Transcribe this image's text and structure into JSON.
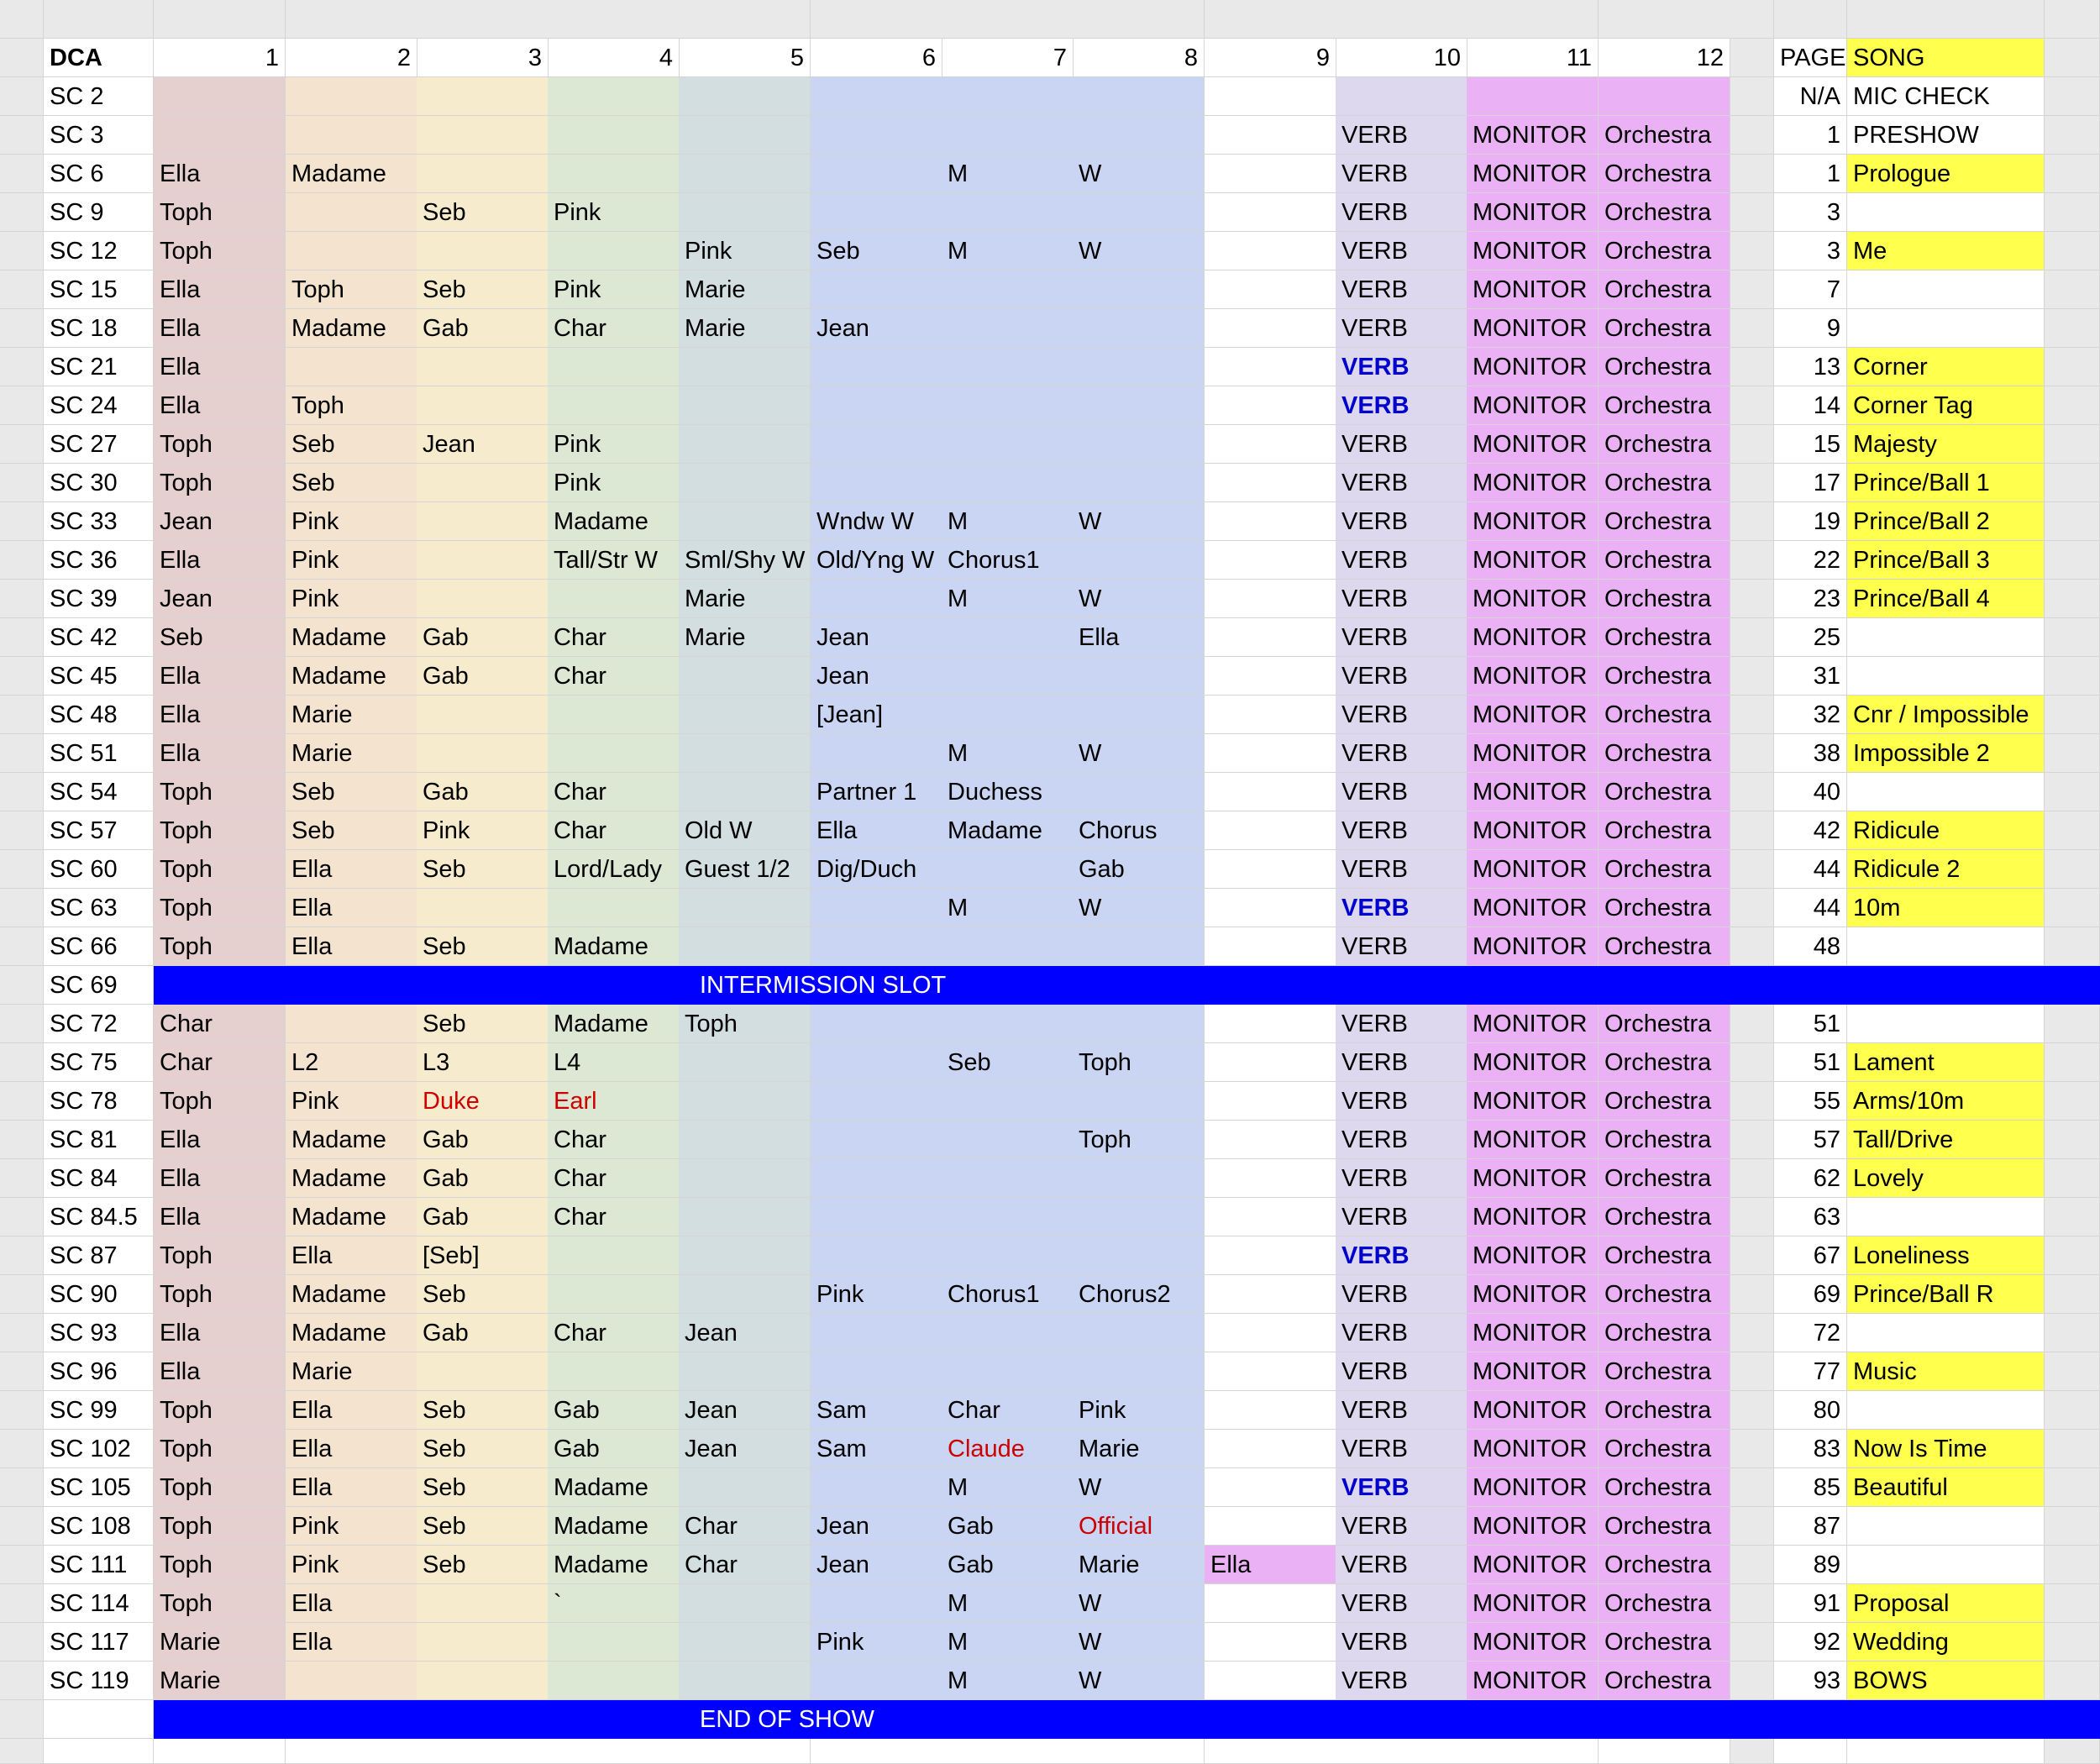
{
  "colors": {
    "ch1": "#e6cfcf",
    "ch2": "#f3e3cf",
    "ch3": "#f6ebcd",
    "ch4": "#dce7d4",
    "ch5": "#d2dee0",
    "ch6": "#cad5f3",
    "ch10": "#ddd8ee",
    "ch11": "#ebb1f5",
    "song": "#ffff4d",
    "header": "#e9e9e9",
    "banner": "#0000ff",
    "text_red": "#cc0000",
    "text_blue": "#0000cc"
  },
  "header": {
    "dca": "DCA",
    "channels": [
      "1",
      "2",
      "3",
      "4",
      "5",
      "6",
      "7",
      "8",
      "9",
      "10",
      "11",
      "12"
    ],
    "page": "PAGE",
    "song": "SONG"
  },
  "rows": [
    {
      "sc": "SC 2",
      "ch": [
        "",
        "",
        "",
        "",
        "",
        "",
        "",
        "",
        "",
        "",
        "",
        ""
      ],
      "page": "N/A",
      "song": "MIC CHECK",
      "song_hl": false
    },
    {
      "sc": "SC 3",
      "ch": [
        "",
        "",
        "",
        "",
        "",
        "",
        "",
        "",
        "",
        "VERB",
        "MONITOR",
        "Orchestra"
      ],
      "page": "1",
      "song": "PRESHOW",
      "song_hl": false
    },
    {
      "sc": "SC 6",
      "ch": [
        "Ella",
        "Madame",
        "",
        "",
        "",
        "",
        "M",
        "W",
        "",
        "VERB",
        "MONITOR",
        "Orchestra"
      ],
      "page": "1",
      "song": "Prologue",
      "song_hl": true
    },
    {
      "sc": "SC 9",
      "ch": [
        "Toph",
        "",
        "Seb",
        "Pink",
        "",
        "",
        "",
        "",
        "",
        "VERB",
        "MONITOR",
        "Orchestra"
      ],
      "page": "3",
      "song": "",
      "song_hl": false
    },
    {
      "sc": "SC 12",
      "ch": [
        "Toph",
        "",
        "",
        "",
        "Pink",
        "Seb",
        "M",
        "W",
        "",
        "VERB",
        "MONITOR",
        "Orchestra"
      ],
      "page": "3",
      "song": "Me",
      "song_hl": true
    },
    {
      "sc": "SC 15",
      "ch": [
        "Ella",
        "Toph",
        "Seb",
        "Pink",
        "Marie",
        "",
        "",
        "",
        "",
        "VERB",
        "MONITOR",
        "Orchestra"
      ],
      "page": "7",
      "song": "",
      "song_hl": false
    },
    {
      "sc": "SC 18",
      "ch": [
        "Ella",
        "Madame",
        "Gab",
        "Char",
        "Marie",
        "Jean",
        "",
        "",
        "",
        "VERB",
        "MONITOR",
        "Orchestra"
      ],
      "page": "9",
      "song": "",
      "song_hl": false
    },
    {
      "sc": "SC 21",
      "ch": [
        "Ella",
        "",
        "",
        "",
        "",
        "",
        "",
        "",
        "",
        "VERB",
        "MONITOR",
        "Orchestra"
      ],
      "verb_blue": true,
      "page": "13",
      "song": "Corner",
      "song_hl": true
    },
    {
      "sc": "SC 24",
      "ch": [
        "Ella",
        "Toph",
        "",
        "",
        "",
        "",
        "",
        "",
        "",
        "VERB",
        "MONITOR",
        "Orchestra"
      ],
      "verb_blue": true,
      "page": "14",
      "song": "Corner Tag",
      "song_hl": true
    },
    {
      "sc": "SC 27",
      "ch": [
        "Toph",
        "Seb",
        "Jean",
        "Pink",
        "",
        "",
        "",
        "",
        "",
        "VERB",
        "MONITOR",
        "Orchestra"
      ],
      "page": "15",
      "song": "Majesty",
      "song_hl": true
    },
    {
      "sc": "SC 30",
      "ch": [
        "Toph",
        "Seb",
        "",
        "Pink",
        "",
        "",
        "",
        "",
        "",
        "VERB",
        "MONITOR",
        "Orchestra"
      ],
      "page": "17",
      "song": "Prince/Ball 1",
      "song_hl": true
    },
    {
      "sc": "SC 33",
      "ch": [
        "Jean",
        "Pink",
        "",
        "Madame",
        "",
        "Wndw W",
        "M",
        "W",
        "",
        "VERB",
        "MONITOR",
        "Orchestra"
      ],
      "page": "19",
      "song": "Prince/Ball 2",
      "song_hl": true
    },
    {
      "sc": "SC 36",
      "ch": [
        "Ella",
        "Pink",
        "",
        "Tall/Str W",
        "Sml/Shy W",
        "Old/Yng W",
        "Chorus1",
        "",
        "",
        "VERB",
        "MONITOR",
        "Orchestra"
      ],
      "page": "22",
      "song": "Prince/Ball 3",
      "song_hl": true
    },
    {
      "sc": "SC 39",
      "ch": [
        "Jean",
        "Pink",
        "",
        "",
        "Marie",
        "",
        "M",
        "W",
        "",
        "VERB",
        "MONITOR",
        "Orchestra"
      ],
      "page": "23",
      "song": "Prince/Ball 4",
      "song_hl": true
    },
    {
      "sc": "SC 42",
      "ch": [
        "Seb",
        "Madame",
        "Gab",
        "Char",
        "Marie",
        "Jean",
        "",
        "Ella",
        "",
        "VERB",
        "MONITOR",
        "Orchestra"
      ],
      "page": "25",
      "song": "",
      "song_hl": false
    },
    {
      "sc": "SC 45",
      "ch": [
        "Ella",
        "Madame",
        "Gab",
        "Char",
        "",
        "Jean",
        "",
        "",
        "",
        "VERB",
        "MONITOR",
        "Orchestra"
      ],
      "page": "31",
      "song": "",
      "song_hl": false
    },
    {
      "sc": "SC 48",
      "ch": [
        "Ella",
        "Marie",
        "",
        "",
        "",
        "[Jean]",
        "",
        "",
        "",
        "VERB",
        "MONITOR",
        "Orchestra"
      ],
      "page": "32",
      "song": "Cnr / Impossible",
      "song_hl": true
    },
    {
      "sc": "SC 51",
      "ch": [
        "Ella",
        "Marie",
        "",
        "",
        "",
        "",
        "M",
        "W",
        "",
        "VERB",
        "MONITOR",
        "Orchestra"
      ],
      "page": "38",
      "song": "Impossible 2",
      "song_hl": true
    },
    {
      "sc": "SC 54",
      "ch": [
        "Toph",
        "Seb",
        "Gab",
        "Char",
        "",
        "Partner 1",
        "Duchess",
        "",
        "",
        "VERB",
        "MONITOR",
        "Orchestra"
      ],
      "page": "40",
      "song": "",
      "song_hl": false
    },
    {
      "sc": "SC 57",
      "ch": [
        "Toph",
        "Seb",
        "Pink",
        "Char",
        "Old W",
        "Ella",
        "Madame",
        "Chorus",
        "",
        "VERB",
        "MONITOR",
        "Orchestra"
      ],
      "page": "42",
      "song": "Ridicule",
      "song_hl": true
    },
    {
      "sc": "SC 60",
      "ch": [
        "Toph",
        "Ella",
        "Seb",
        "Lord/Lady",
        "Guest 1/2",
        "Dig/Duch",
        "",
        "Gab",
        "",
        "VERB",
        "MONITOR",
        "Orchestra"
      ],
      "page": "44",
      "song": "Ridicule 2",
      "song_hl": true
    },
    {
      "sc": "SC 63",
      "ch": [
        "Toph",
        "Ella",
        "",
        "",
        "",
        "",
        "M",
        "W",
        "",
        "VERB",
        "MONITOR",
        "Orchestra"
      ],
      "verb_blue": true,
      "page": "44",
      "song": "10m",
      "song_hl": true
    },
    {
      "sc": "SC 66",
      "ch": [
        "Toph",
        "Ella",
        "Seb",
        "Madame",
        "",
        "",
        "",
        "",
        "",
        "VERB",
        "MONITOR",
        "Orchestra"
      ],
      "page": "48",
      "song": "",
      "song_hl": false
    },
    {
      "sc": "SC 69",
      "banner": "INTERMISSION SLOT"
    },
    {
      "sc": "SC 72",
      "ch": [
        "Char",
        "",
        "Seb",
        "Madame",
        "Toph",
        "",
        "",
        "",
        "",
        "VERB",
        "MONITOR",
        "Orchestra"
      ],
      "page": "51",
      "song": "",
      "song_hl": false
    },
    {
      "sc": "SC 75",
      "ch": [
        "Char",
        "L2",
        "L3",
        "L4",
        "",
        "",
        "Seb",
        "Toph",
        "",
        "VERB",
        "MONITOR",
        "Orchestra"
      ],
      "page": "51",
      "song": "Lament",
      "song_hl": true
    },
    {
      "sc": "SC 78",
      "ch": [
        "Toph",
        "Pink",
        "Duke",
        "Earl",
        "",
        "",
        "",
        "",
        "",
        "VERB",
        "MONITOR",
        "Orchestra"
      ],
      "red": [
        2,
        3
      ],
      "page": "55",
      "song": "Arms/10m",
      "song_hl": true
    },
    {
      "sc": "SC 81",
      "ch": [
        "Ella",
        "Madame",
        "Gab",
        "Char",
        "",
        "",
        "",
        "Toph",
        "",
        "VERB",
        "MONITOR",
        "Orchestra"
      ],
      "page": "57",
      "song": "Tall/Drive",
      "song_hl": true
    },
    {
      "sc": "SC 84",
      "ch": [
        "Ella",
        "Madame",
        "Gab",
        "Char",
        "",
        "",
        "",
        "",
        "",
        "VERB",
        "MONITOR",
        "Orchestra"
      ],
      "page": "62",
      "song": "Lovely",
      "song_hl": true
    },
    {
      "sc": "SC 84.5",
      "ch": [
        "Ella",
        "Madame",
        "Gab",
        "Char",
        "",
        "",
        "",
        "",
        "",
        "VERB",
        "MONITOR",
        "Orchestra"
      ],
      "page": "63",
      "song": "",
      "song_hl": false
    },
    {
      "sc": "SC 87",
      "ch": [
        "Toph",
        "Ella",
        "[Seb]",
        "",
        "",
        "",
        "",
        "",
        "",
        "VERB",
        "MONITOR",
        "Orchestra"
      ],
      "verb_blue": true,
      "page": "67",
      "song": "Loneliness",
      "song_hl": true
    },
    {
      "sc": "SC 90",
      "ch": [
        "Toph",
        "Madame",
        "Seb",
        "",
        "",
        "Pink",
        "Chorus1",
        "Chorus2",
        "",
        "VERB",
        "MONITOR",
        "Orchestra"
      ],
      "page": "69",
      "song": "Prince/Ball R",
      "song_hl": true
    },
    {
      "sc": "SC 93",
      "ch": [
        "Ella",
        "Madame",
        "Gab",
        "Char",
        "Jean",
        "",
        "",
        "",
        "",
        "VERB",
        "MONITOR",
        "Orchestra"
      ],
      "page": "72",
      "song": "",
      "song_hl": false
    },
    {
      "sc": "SC 96",
      "ch": [
        "Ella",
        "Marie",
        "",
        "",
        "",
        "",
        "",
        "",
        "",
        "VERB",
        "MONITOR",
        "Orchestra"
      ],
      "page": "77",
      "song": "Music",
      "song_hl": true
    },
    {
      "sc": "SC 99",
      "ch": [
        "Toph",
        "Ella",
        "Seb",
        "Gab",
        "Jean",
        "Sam",
        "Char",
        "Pink",
        "",
        "VERB",
        "MONITOR",
        "Orchestra"
      ],
      "page": "80",
      "song": "",
      "song_hl": false
    },
    {
      "sc": "SC 102",
      "ch": [
        "Toph",
        "Ella",
        "Seb",
        "Gab",
        "Jean",
        "Sam",
        "Claude",
        "Marie",
        "",
        "VERB",
        "MONITOR",
        "Orchestra"
      ],
      "red": [
        6
      ],
      "page": "83",
      "song": "Now Is Time",
      "song_hl": true
    },
    {
      "sc": "SC 105",
      "ch": [
        "Toph",
        "Ella",
        "Seb",
        "Madame",
        "",
        "",
        "M",
        "W",
        "",
        "VERB",
        "MONITOR",
        "Orchestra"
      ],
      "verb_blue": true,
      "page": "85",
      "song": "Beautiful",
      "song_hl": true
    },
    {
      "sc": "SC 108",
      "ch": [
        "Toph",
        "Pink",
        "Seb",
        "Madame",
        "Char",
        "Jean",
        "Gab",
        "Official",
        "",
        "VERB",
        "MONITOR",
        "Orchestra"
      ],
      "red": [
        7
      ],
      "page": "87",
      "song": "",
      "song_hl": false
    },
    {
      "sc": "SC 111",
      "ch": [
        "Toph",
        "Pink",
        "Seb",
        "Madame",
        "Char",
        "Jean",
        "Gab",
        "Marie",
        "Ella",
        "VERB",
        "MONITOR",
        "Orchestra"
      ],
      "ch9_pink": true,
      "page": "89",
      "song": "",
      "song_hl": false
    },
    {
      "sc": "SC 114",
      "ch": [
        "Toph",
        "Ella",
        "",
        "`",
        "",
        "",
        "M",
        "W",
        "",
        "VERB",
        "MONITOR",
        "Orchestra"
      ],
      "page": "91",
      "song": "Proposal",
      "song_hl": true
    },
    {
      "sc": "SC 117",
      "ch": [
        "Marie",
        "Ella",
        "",
        "",
        "",
        "Pink",
        "M",
        "W",
        "",
        "VERB",
        "MONITOR",
        "Orchestra"
      ],
      "page": "92",
      "song": "Wedding",
      "song_hl": true
    },
    {
      "sc": "SC 119",
      "ch": [
        "Marie",
        "",
        "",
        "",
        "",
        "",
        "M",
        "W",
        "",
        "VERB",
        "MONITOR",
        "Orchestra"
      ],
      "page": "93",
      "song": "BOWS",
      "song_hl": true
    },
    {
      "sc": "",
      "banner": "END OF SHOW"
    }
  ]
}
